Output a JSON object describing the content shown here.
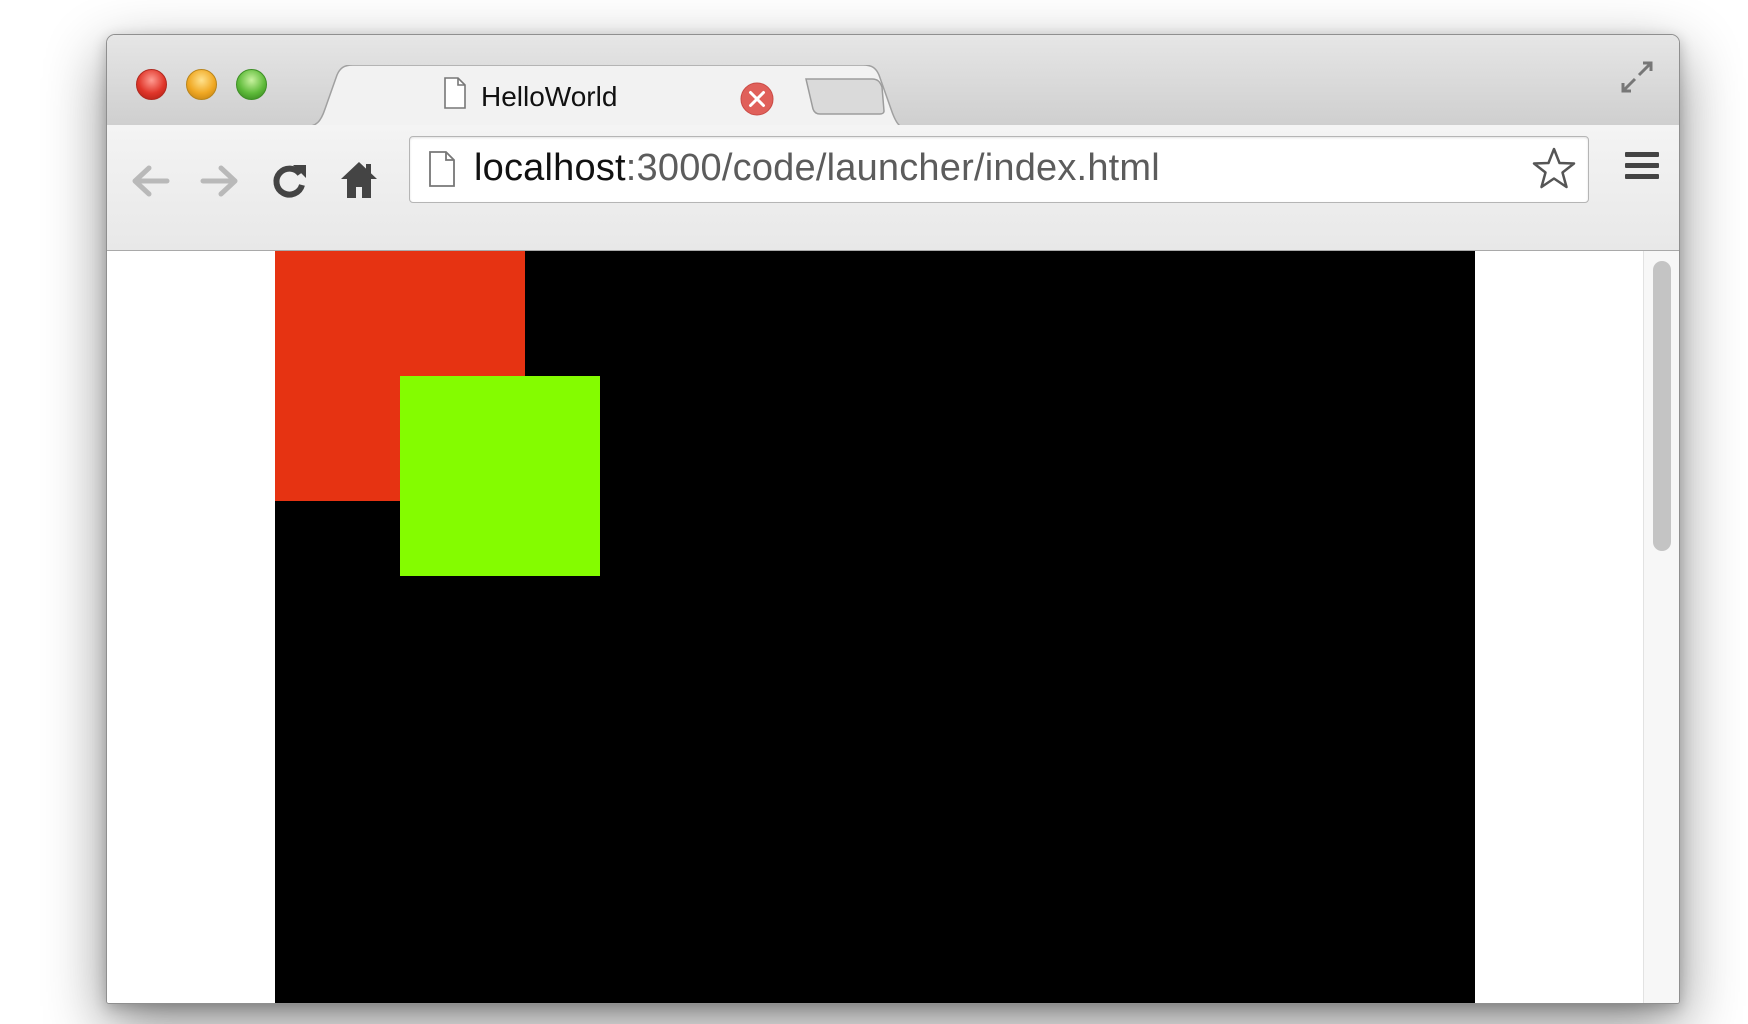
{
  "window": {
    "tab": {
      "title": "HelloWorld"
    }
  },
  "toolbar": {
    "url_host": "localhost",
    "url_rest": ":3000/code/launcher/index.html"
  },
  "colors": {
    "canvas": "#000000",
    "red_square": "#e63312",
    "green_square": "#84fc00",
    "tab_close": "#e0605a"
  },
  "icons": [
    "back-arrow-icon",
    "forward-arrow-icon",
    "reload-icon",
    "home-icon",
    "document-icon",
    "star-icon",
    "menu-icon",
    "close-icon",
    "fullscreen-icon"
  ]
}
